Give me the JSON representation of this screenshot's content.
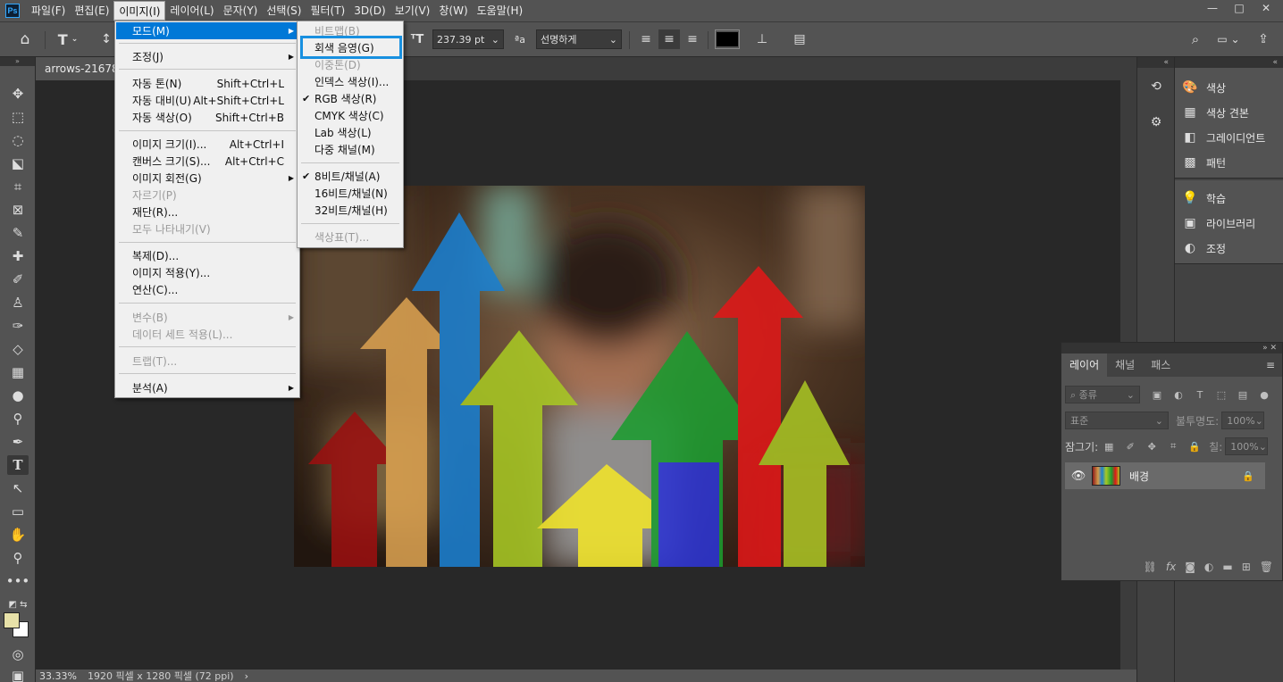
{
  "menubar": {
    "items": [
      "파일(F)",
      "편집(E)",
      "이미지(I)",
      "레이어(L)",
      "문자(Y)",
      "선택(S)",
      "필터(T)",
      "3D(D)",
      "보기(V)",
      "창(W)",
      "도움말(H)"
    ],
    "logo": "Ps",
    "window_controls": [
      "—",
      "□",
      "✕"
    ]
  },
  "options": {
    "font_size": "237.39 pt",
    "antialias": "선명하게",
    "text_color": "#000000"
  },
  "document": {
    "tab_name": "arrows-2167843"
  },
  "status": {
    "zoom": "33.33%",
    "size": "1920 픽셀 x 1280 픽셀 (72 ppi)"
  },
  "image_menu": {
    "items": [
      {
        "label": "모드(M)",
        "shortcut": "",
        "submenu": true,
        "disabled": false,
        "highlighted": true
      },
      {
        "label": "조정(J)",
        "shortcut": "",
        "submenu": true,
        "disabled": false
      },
      {
        "label": "자동 톤(N)",
        "shortcut": "Shift+Ctrl+L",
        "disabled": false
      },
      {
        "label": "자동 대비(U)",
        "shortcut": "Alt+Shift+Ctrl+L",
        "disabled": false
      },
      {
        "label": "자동 색상(O)",
        "shortcut": "Shift+Ctrl+B",
        "disabled": false
      },
      {
        "label": "이미지 크기(I)...",
        "shortcut": "Alt+Ctrl+I",
        "disabled": false
      },
      {
        "label": "캔버스 크기(S)...",
        "shortcut": "Alt+Ctrl+C",
        "disabled": false
      },
      {
        "label": "이미지 회전(G)",
        "shortcut": "",
        "submenu": true,
        "disabled": false
      },
      {
        "label": "자르기(P)",
        "shortcut": "",
        "disabled": true
      },
      {
        "label": "재단(R)...",
        "shortcut": "",
        "disabled": false
      },
      {
        "label": "모두 나타내기(V)",
        "shortcut": "",
        "disabled": true
      },
      {
        "label": "복제(D)...",
        "shortcut": "",
        "disabled": false
      },
      {
        "label": "이미지 적용(Y)...",
        "shortcut": "",
        "disabled": false
      },
      {
        "label": "연산(C)...",
        "shortcut": "",
        "disabled": false
      },
      {
        "label": "변수(B)",
        "shortcut": "",
        "submenu": true,
        "disabled": true
      },
      {
        "label": "데이터 세트 적용(L)...",
        "shortcut": "",
        "disabled": true
      },
      {
        "label": "트랩(T)...",
        "shortcut": "",
        "disabled": true
      },
      {
        "label": "분석(A)",
        "shortcut": "",
        "submenu": true,
        "disabled": false
      }
    ]
  },
  "mode_menu": {
    "items": [
      {
        "label": "비트맵(B)",
        "disabled": true,
        "checked": false
      },
      {
        "label": "회색 음영(G)",
        "disabled": false,
        "checked": false
      },
      {
        "label": "이중톤(D)",
        "disabled": true,
        "checked": false
      },
      {
        "label": "인덱스 색상(I)...",
        "disabled": false,
        "checked": false
      },
      {
        "label": "RGB 색상(R)",
        "disabled": false,
        "checked": true
      },
      {
        "label": "CMYK 색상(C)",
        "disabled": false,
        "checked": false
      },
      {
        "label": "Lab 색상(L)",
        "disabled": false,
        "checked": false
      },
      {
        "label": "다중 채널(M)",
        "disabled": false,
        "checked": false
      },
      {
        "label": "8비트/채널(A)",
        "disabled": false,
        "checked": true
      },
      {
        "label": "16비트/채널(N)",
        "disabled": false,
        "checked": false
      },
      {
        "label": "32비트/채널(H)",
        "disabled": false,
        "checked": false
      },
      {
        "label": "색상표(T)...",
        "disabled": true,
        "checked": false
      }
    ]
  },
  "right_panels": {
    "group1": [
      "색상",
      "색상 견본",
      "그레이디언트",
      "패턴"
    ],
    "group2": [
      "학습",
      "라이브러리",
      "조정"
    ]
  },
  "layers": {
    "tabs": [
      "레이어",
      "채널",
      "패스"
    ],
    "filter_placeholder": "종류",
    "blend_mode": "표준",
    "opacity_label": "불투명도:",
    "opacity_value": "100%",
    "lock_label": "잠그기:",
    "fill_label": "칠:",
    "fill_value": "100%",
    "layer_name": "배경"
  }
}
